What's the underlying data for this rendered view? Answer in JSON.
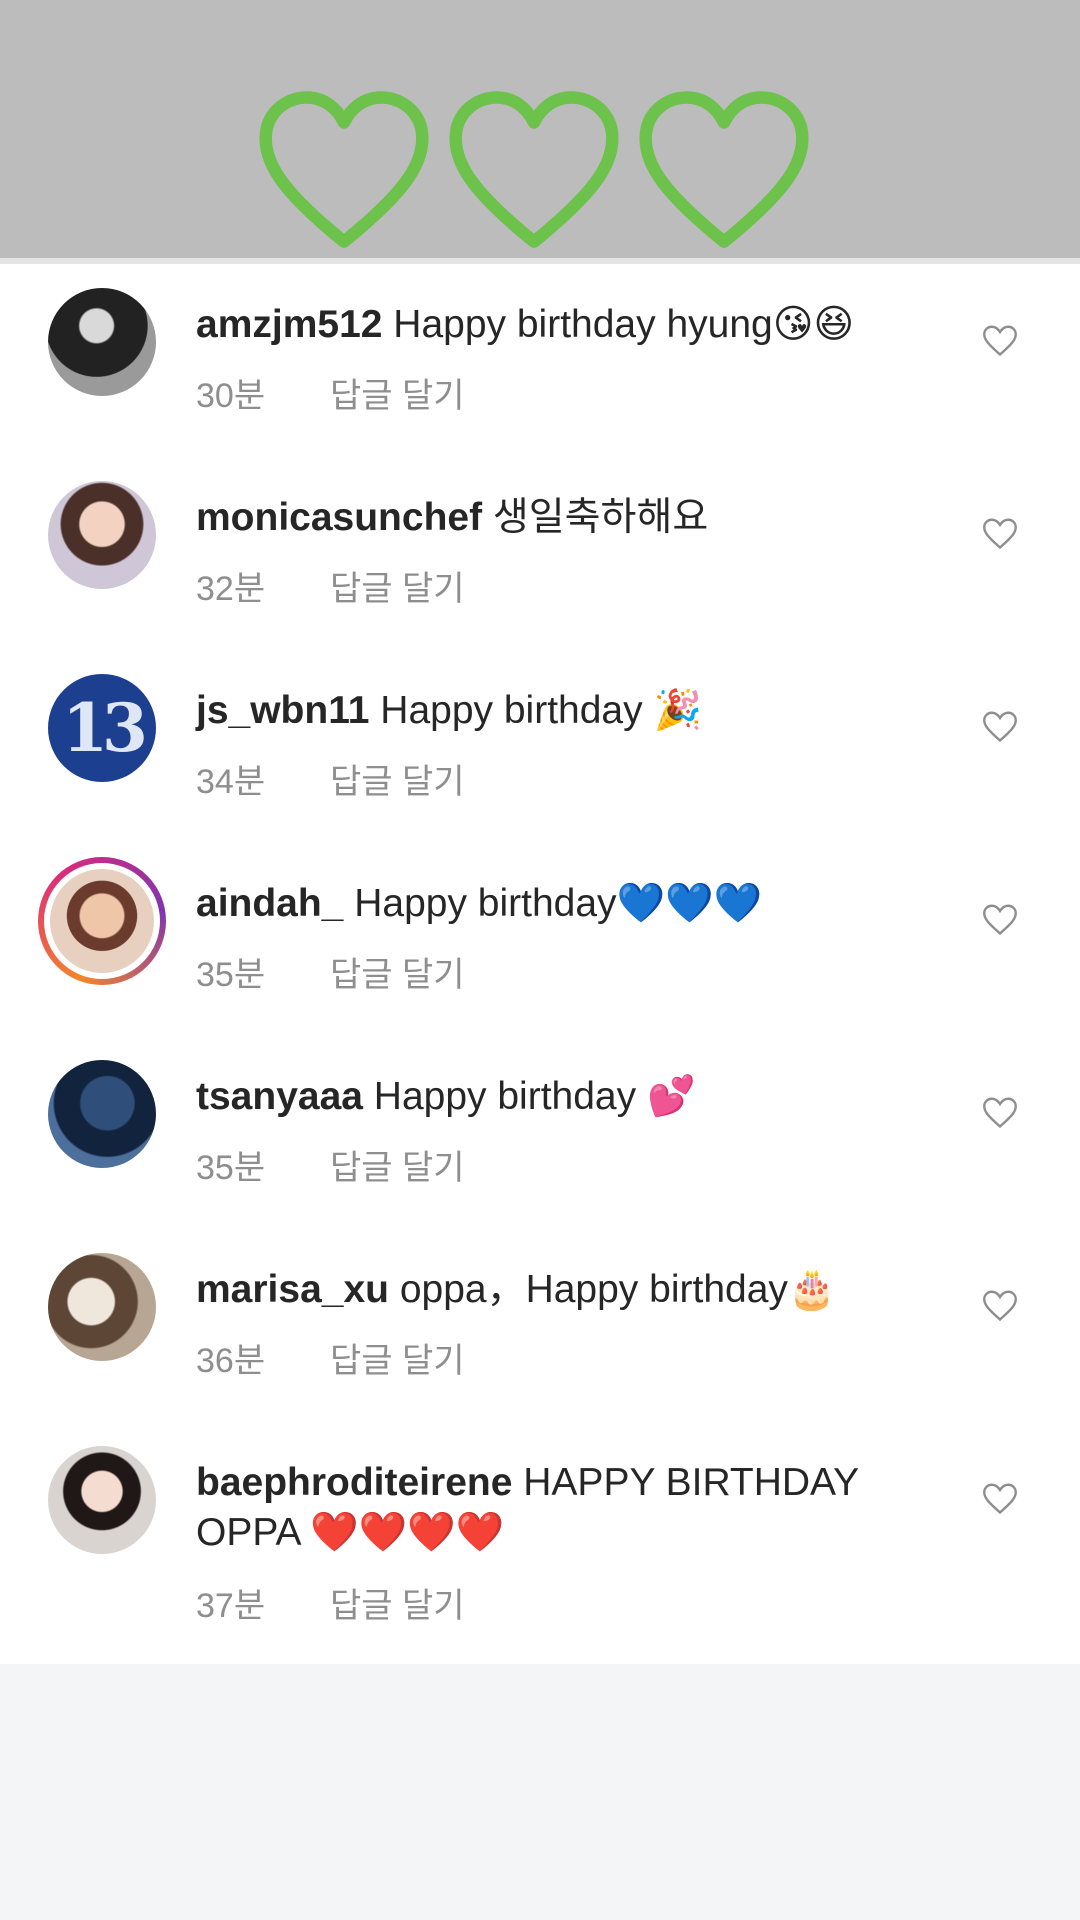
{
  "banner": {
    "hearts": [
      "green-heart-outline",
      "green-heart-outline",
      "green-heart-outline"
    ],
    "heart_color": "#6cc24a"
  },
  "comments": [
    {
      "username": "amzjm512",
      "text": "Happy birthday hyung",
      "emoji": "😘😆",
      "time": "30분",
      "reply": "답글 달기"
    },
    {
      "username": "monicasunchef",
      "text": "생일축하해요",
      "emoji": "",
      "time": "32분",
      "reply": "답글 달기"
    },
    {
      "username": "js_wbn11",
      "text": "Happy birthday",
      "emoji": "🎉",
      "time": "34분",
      "reply": "답글 달기",
      "avatar_text": "13"
    },
    {
      "username": "aindah_",
      "text": "Happy birthday",
      "emoji": "💙💙💙",
      "time": "35분",
      "reply": "답글 달기"
    },
    {
      "username": "tsanyaaa",
      "text": "Happy birthday",
      "emoji": "💕",
      "time": "35분",
      "reply": "답글 달기"
    },
    {
      "username": "marisa_xu",
      "text": "oppa，Happy birthday",
      "emoji": "🎂",
      "time": "36분",
      "reply": "답글 달기"
    },
    {
      "username": "baephroditeirene",
      "text": "HAPPY BIRTHDAY OPPA",
      "emoji": "❤️❤️❤️❤️",
      "time": "37분",
      "reply": "답글 달기"
    }
  ],
  "colors": {
    "text": "#262626",
    "meta": "#8e8e8e",
    "like_icon": "#8e8e8e"
  }
}
